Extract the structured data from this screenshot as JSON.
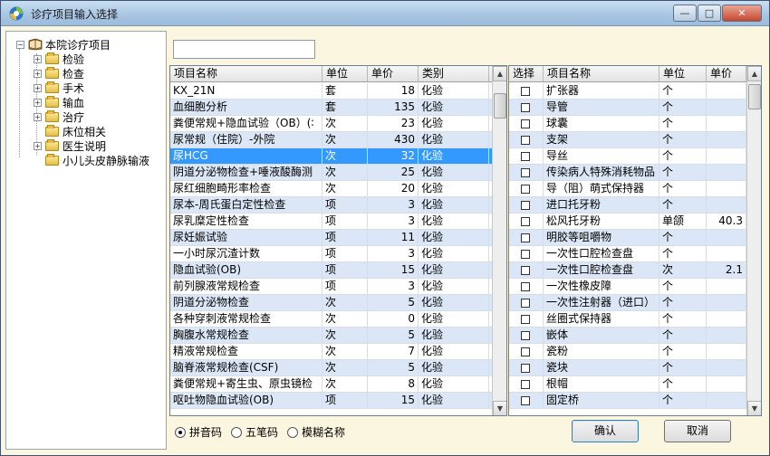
{
  "window": {
    "title": "诊疗项目输入选择",
    "minimize": "—",
    "maximize": "□",
    "close": "✕"
  },
  "tree": {
    "root": "本院诊疗项目",
    "items": [
      {
        "label": "检验",
        "expandable": true
      },
      {
        "label": "检查",
        "expandable": true
      },
      {
        "label": "手术",
        "expandable": true
      },
      {
        "label": "输血",
        "expandable": true
      },
      {
        "label": "治疗",
        "expandable": true
      },
      {
        "label": "床位相关",
        "expandable": false
      },
      {
        "label": "医生说明",
        "expandable": true
      },
      {
        "label": "小儿头皮静脉输液",
        "expandable": false
      }
    ]
  },
  "search": {
    "value": ""
  },
  "left_grid": {
    "columns": [
      "项目名称",
      "单位",
      "单价",
      "类别"
    ],
    "rows": [
      [
        "KX_21N",
        "套",
        "18",
        "化验"
      ],
      [
        "血细胞分析",
        "套",
        "135",
        "化验"
      ],
      [
        "粪便常规+隐血试验（OB）(∶",
        "次",
        "23",
        "化验"
      ],
      [
        "尿常规（住院）-外院",
        "次",
        "430",
        "化验"
      ],
      [
        "尿HCG",
        "次",
        "32",
        "化验"
      ],
      [
        "阴道分泌物检查+唾液酸酶测",
        "次",
        "25",
        "化验"
      ],
      [
        "尿红细胞畸形率检查",
        "次",
        "20",
        "化验"
      ],
      [
        "尿本-周氏蛋白定性检查",
        "项",
        "3",
        "化验"
      ],
      [
        "尿乳糜定性检查",
        "项",
        "3",
        "化验"
      ],
      [
        "尿妊娠试验",
        "项",
        "11",
        "化验"
      ],
      [
        "一小时尿沉渣计数",
        "项",
        "3",
        "化验"
      ],
      [
        "隐血试验(OB)",
        "项",
        "15",
        "化验"
      ],
      [
        "前列腺液常规检查",
        "项",
        "3",
        "化验"
      ],
      [
        "阴道分泌物检查",
        "次",
        "5",
        "化验"
      ],
      [
        "各种穿刺液常规检查",
        "次",
        "0",
        "化验"
      ],
      [
        "胸腹水常规检查",
        "次",
        "5",
        "化验"
      ],
      [
        "精液常规检查",
        "次",
        "7",
        "化验"
      ],
      [
        "脑脊液常规检查(CSF)",
        "次",
        "5",
        "化验"
      ],
      [
        "粪便常规+寄生虫、原虫镜检",
        "次",
        "8",
        "化验"
      ],
      [
        "呕吐物隐血试验(OB)",
        "项",
        "15",
        "化验"
      ]
    ],
    "selected_index": 4
  },
  "right_grid": {
    "columns": [
      "选择",
      "项目名称",
      "单位",
      "单价"
    ],
    "rows": [
      [
        "扩张器",
        "个",
        ""
      ],
      [
        "导管",
        "个",
        ""
      ],
      [
        "球囊",
        "个",
        ""
      ],
      [
        "支架",
        "个",
        ""
      ],
      [
        "导丝",
        "个",
        ""
      ],
      [
        "传染病人特殊消耗物品",
        "个",
        ""
      ],
      [
        "导（阻）萌式保持器",
        "个",
        ""
      ],
      [
        "进口托牙粉",
        "个",
        ""
      ],
      [
        "松风托牙粉",
        "单颌",
        "40.3"
      ],
      [
        "明胶等咀嚼物",
        "个",
        ""
      ],
      [
        "一次性口腔检查盘",
        "个",
        ""
      ],
      [
        "一次性口腔检查盘",
        "次",
        "2.1"
      ],
      [
        "一次性橡皮障",
        "个",
        ""
      ],
      [
        "一次性注射器（进口）",
        "个",
        ""
      ],
      [
        "丝圈式保持器",
        "个",
        ""
      ],
      [
        "嵌体",
        "个",
        ""
      ],
      [
        "瓷粉",
        "个",
        ""
      ],
      [
        "瓷块",
        "个",
        ""
      ],
      [
        "根帽",
        "个",
        ""
      ],
      [
        "固定桥",
        "个",
        ""
      ]
    ]
  },
  "search_modes": [
    {
      "label": "拼音码",
      "checked": true
    },
    {
      "label": "五笔码",
      "checked": false
    },
    {
      "label": "模糊名称",
      "checked": false
    }
  ],
  "buttons": {
    "ok": "确认",
    "cancel": "取消"
  }
}
